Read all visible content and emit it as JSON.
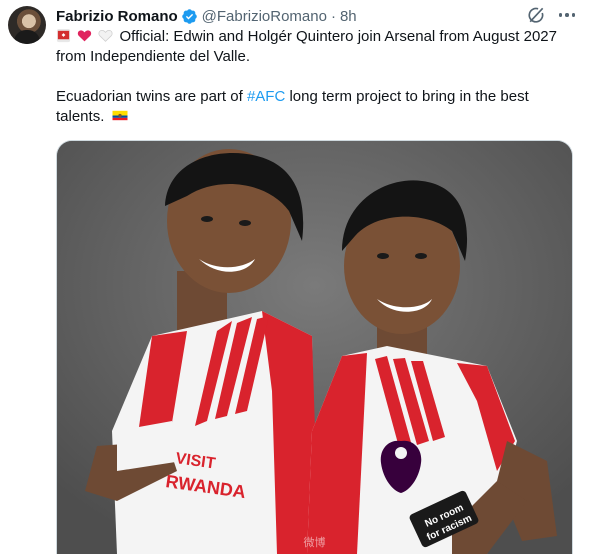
{
  "author": {
    "name": "Fabrizio Romano",
    "handle": "@FabrizioRomano",
    "separator": "·",
    "time": "8h",
    "avatar_icon": "profile-photo",
    "verified_icon": "verified-badge-icon"
  },
  "actions": {
    "grok_icon": "grok-icon",
    "more_icon": "more-options-icon"
  },
  "tweet": {
    "line1_emojis": [
      "red-flag-emoji",
      "red-heart-emoji",
      "white-heart-emoji"
    ],
    "line1": "Official: Edwin and Holgér Quintero join Arsenal from August 2027",
    "line2": "from Independiente del Valle.",
    "line3_before": "Ecuadorian twins are part of ",
    "hashtag": "#AFC",
    "line3_after": " long term project to bring in the best",
    "line4": "talents.",
    "line4_emoji": "ecuador-flag-emoji"
  },
  "media": {
    "sponsor_line1": "VISIT",
    "sponsor_line2": "RWANDA",
    "sleeve_line1": "No room",
    "sleeve_line2": "for racism",
    "watermark": "微博"
  },
  "colors": {
    "accent": "#1d9bf0",
    "text": "#0f1419",
    "secondary": "#536471",
    "arsenal_red": "#d9232d"
  }
}
